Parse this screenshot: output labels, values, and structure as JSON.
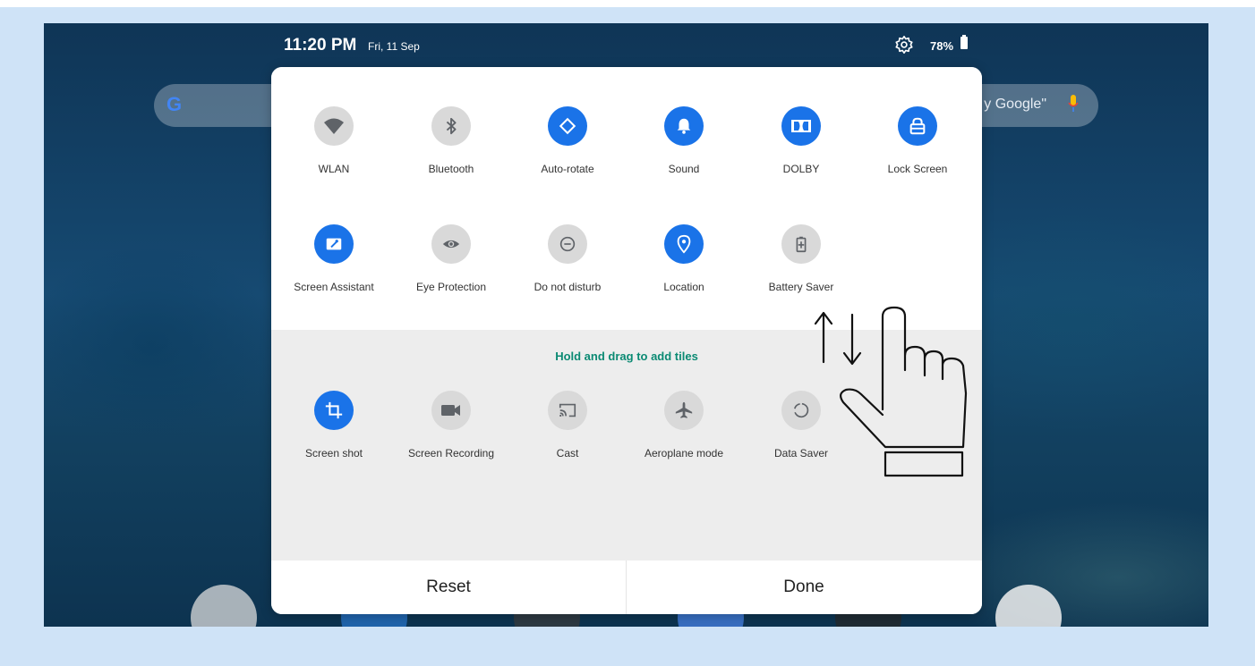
{
  "status": {
    "time": "11:20 PM",
    "date": "Fri, 11 Sep",
    "battery": "78%"
  },
  "search": {
    "hint": "y Google\""
  },
  "active_tiles": [
    {
      "label": "WLAN",
      "icon": "wifi-icon",
      "state": "off"
    },
    {
      "label": "Bluetooth",
      "icon": "bluetooth-icon",
      "state": "off"
    },
    {
      "label": "Auto-rotate",
      "icon": "auto-rotate-icon",
      "state": "on"
    },
    {
      "label": "Sound",
      "icon": "bell-icon",
      "state": "on"
    },
    {
      "label": "DOLBY",
      "icon": "dolby-icon",
      "state": "on"
    },
    {
      "label": "Lock Screen",
      "icon": "lock-icon",
      "state": "on"
    },
    {
      "label": "Screen Assistant",
      "icon": "wrench-icon",
      "state": "on"
    },
    {
      "label": "Eye Protection",
      "icon": "eye-icon",
      "state": "off"
    },
    {
      "label": "Do not disturb",
      "icon": "do-not-disturb-icon",
      "state": "off"
    },
    {
      "label": "Location",
      "icon": "location-pin-icon",
      "state": "on"
    },
    {
      "label": "Battery Saver",
      "icon": "battery-saver-icon",
      "state": "off"
    }
  ],
  "available_hint": "Hold and drag to add tiles",
  "available_tiles": [
    {
      "label": "Screen shot",
      "icon": "crop-icon",
      "state": "on"
    },
    {
      "label": "Screen Recording",
      "icon": "video-camera-icon",
      "state": "off"
    },
    {
      "label": "Cast",
      "icon": "cast-icon",
      "state": "off"
    },
    {
      "label": "Aeroplane mode",
      "icon": "airplane-icon",
      "state": "off"
    },
    {
      "label": "Data Saver",
      "icon": "data-saver-icon",
      "state": "off"
    }
  ],
  "buttons": {
    "reset": "Reset",
    "done": "Done"
  },
  "colors": {
    "accent": "#1a73e8",
    "hint_text": "#0b8a73",
    "tile_off": "#d9d9d9",
    "frame": "#cfe3f7"
  }
}
